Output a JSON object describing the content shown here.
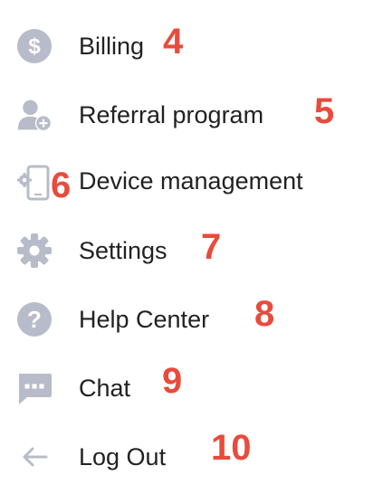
{
  "accent_color": "#e84b3c",
  "icon_color": "#b8bcca",
  "menu": {
    "items": [
      {
        "label": "Billing",
        "number": "4",
        "icon": "dollar-circle-icon"
      },
      {
        "label": "Referral program",
        "number": "5",
        "icon": "add-user-icon"
      },
      {
        "label": "Device management",
        "number": "6",
        "icon": "device-settings-icon"
      },
      {
        "label": "Settings",
        "number": "7",
        "icon": "gear-icon"
      },
      {
        "label": "Help Center",
        "number": "8",
        "icon": "question-circle-icon"
      },
      {
        "label": "Chat",
        "number": "9",
        "icon": "chat-bubble-icon"
      },
      {
        "label": "Log Out",
        "number": "10",
        "icon": "arrow-left-icon"
      }
    ]
  }
}
